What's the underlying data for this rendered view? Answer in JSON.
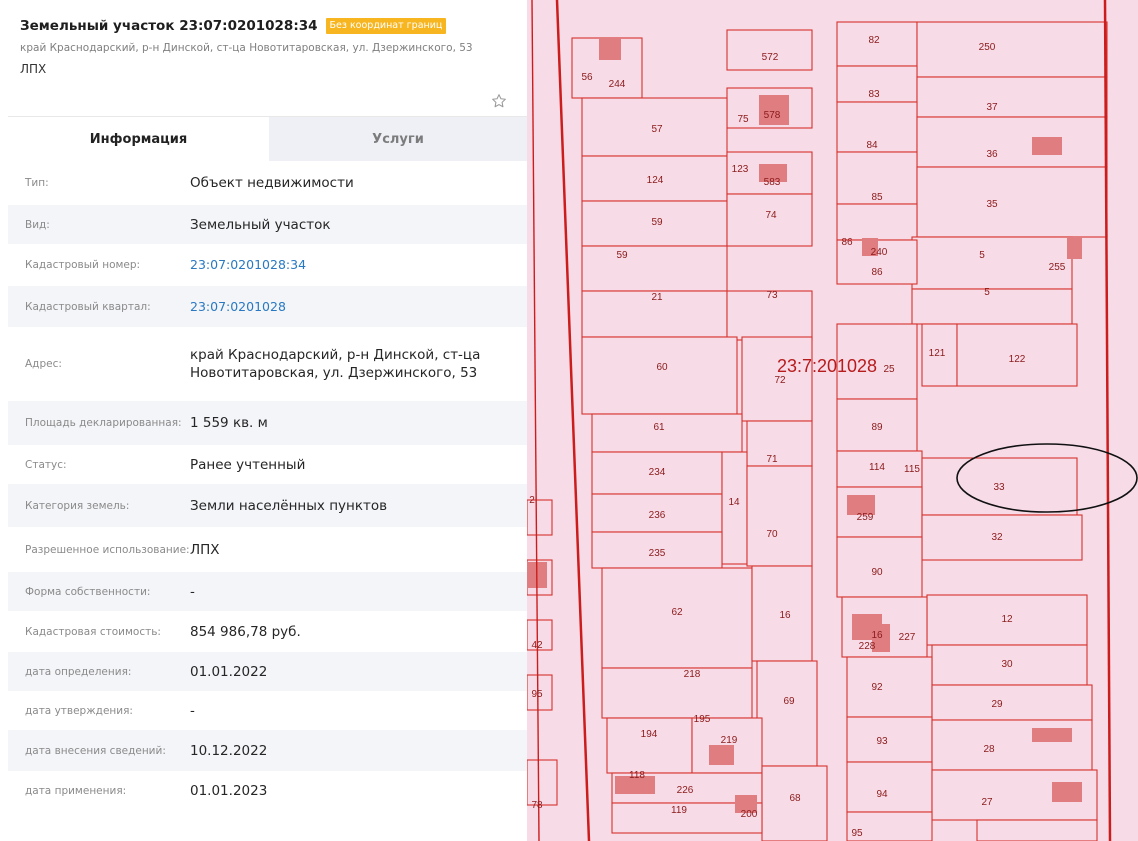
{
  "header": {
    "title": "Земельный участок 23:07:0201028:34",
    "badge": "Без координат границ",
    "address": "край Краснодарский, р-н Динской, ст-ца Новотитаровская, ул. Дзержинского, 53",
    "short_use": "ЛПХ",
    "star_icon": "star-outline-icon"
  },
  "tabs": [
    {
      "label": "Информация",
      "active": true
    },
    {
      "label": "Услуги",
      "active": false
    }
  ],
  "info_rows": [
    {
      "label": "Тип:",
      "value": "Объект недвижимости"
    },
    {
      "label": "Вид:",
      "value": "Земельный участок"
    },
    {
      "label": "Кадастровый номер:",
      "value": "23:07:0201028:34",
      "link": true
    },
    {
      "label": "Кадастровый квартал:",
      "value": "23:07:0201028",
      "link": true
    },
    {
      "label": "Адрес:",
      "value": "край Краснодарский, р-н Динской, ст-ца Новотитаровская, ул. Дзержинского, 53"
    },
    {
      "label": "Площадь декларированная:",
      "value": "1 559 кв. м"
    },
    {
      "label": "Статус:",
      "value": "Ранее учтенный"
    },
    {
      "label": "Категория земель:",
      "value": "Земли населённых пунктов"
    },
    {
      "label": "Разрешенное использование:",
      "value": "ЛПХ"
    },
    {
      "label": "Форма собственности:",
      "value": "-"
    },
    {
      "label": "Кадастровая стоимость:",
      "value": "854 986,78 руб."
    },
    {
      "label": "дата определения:",
      "value": "01.01.2022"
    },
    {
      "label": "дата утверждения:",
      "value": "-"
    },
    {
      "label": "дата внесения сведений:",
      "value": "10.12.2022"
    },
    {
      "label": "дата применения:",
      "value": "01.01.2023"
    }
  ],
  "map": {
    "quarter_label": "23:7:201028",
    "plot_color": "#f7dce8",
    "boundary_color": "#d7312d",
    "highlight_plot": "33",
    "plot_labels": [
      "56",
      "244",
      "572",
      "82",
      "250",
      "83",
      "37",
      "75",
      "578",
      "57",
      "84",
      "36",
      "124",
      "123",
      "583",
      "85",
      "35",
      "59",
      "74",
      "59",
      "86",
      "240",
      "86",
      "5",
      "255",
      "5",
      "21",
      "73",
      "60",
      "72",
      "25",
      "121",
      "122",
      "61",
      "89",
      "71",
      "234",
      "114",
      "33",
      "115",
      "236",
      "14",
      "259",
      "70",
      "32",
      "235",
      "90",
      "62",
      "16",
      "12",
      "228",
      "16",
      "227",
      "218",
      "30",
      "92",
      "69",
      "95",
      "29",
      "194",
      "195",
      "219",
      "93",
      "28",
      "118",
      "226",
      "68",
      "94",
      "27",
      "119",
      "200",
      "95",
      "78",
      "42",
      "2"
    ]
  }
}
